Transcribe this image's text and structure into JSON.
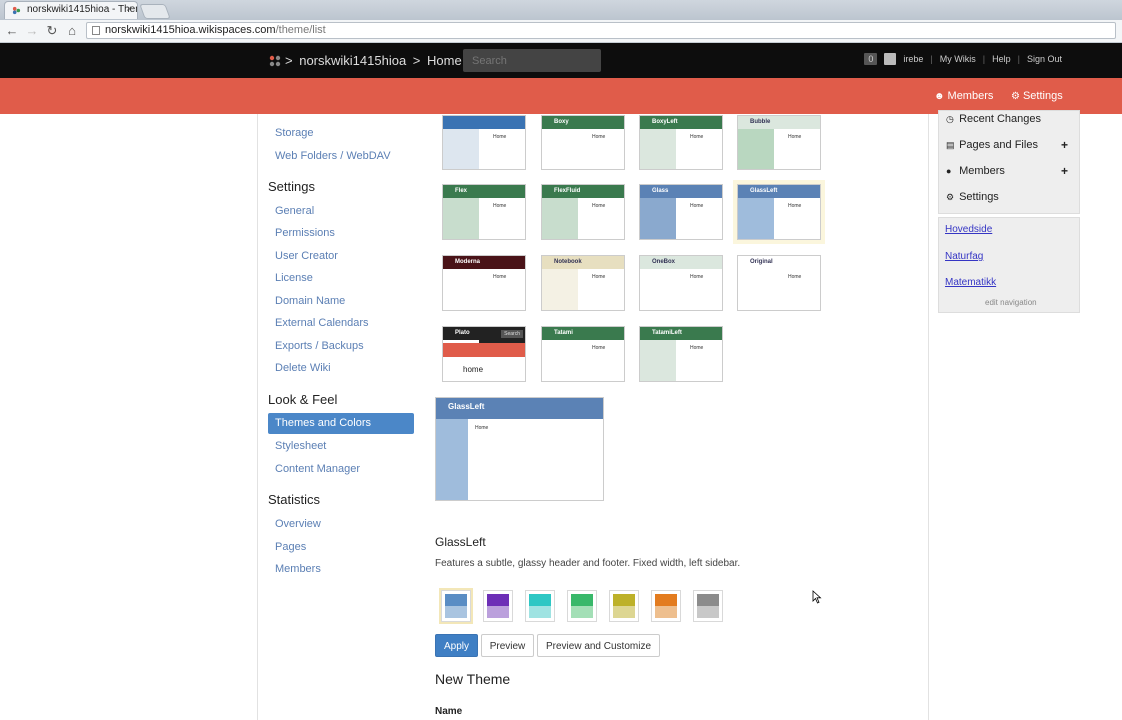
{
  "browser": {
    "tab_title": "norskwiki1415hioa - Them",
    "tab_close": "×",
    "url_host": "norskwiki1415hioa.wikispaces.com",
    "url_path": "/theme/list"
  },
  "header": {
    "wiki_name": "norskwiki1415hioa",
    "separator": ">",
    "home": "Home",
    "search_placeholder": "Search",
    "badge": "0",
    "user": "irebe",
    "links": [
      "My Wikis",
      "Help",
      "Sign Out"
    ],
    "link_sep": "|"
  },
  "subheader": {
    "members": "Members",
    "settings": "Settings"
  },
  "leftnav": {
    "top_links": [
      "Storage",
      "Web Folders / WebDAV"
    ],
    "settings_heading": "Settings",
    "settings_links": [
      "General",
      "Permissions",
      "User Creator",
      "License",
      "Domain Name",
      "External Calendars",
      "Exports / Backups",
      "Delete Wiki"
    ],
    "look_heading": "Look & Feel",
    "look_links": [
      "Themes and Colors",
      "Stylesheet",
      "Content Manager"
    ],
    "stats_heading": "Statistics",
    "stats_links": [
      "Overview",
      "Pages",
      "Members"
    ]
  },
  "themes": {
    "thumbs": [
      {
        "name": "",
        "header_color": "#3a73b3",
        "sidebar_color": "#dde6ef",
        "home": "Home"
      },
      {
        "name": "Boxy",
        "header_color": "#3a7a4e",
        "sidebar_color": "#ffffff",
        "home": "Home"
      },
      {
        "name": "BoxyLeft",
        "header_color": "#3a7a4e",
        "sidebar_color": "#dbe7de",
        "home": "Home"
      },
      {
        "name": "Bubble",
        "header_color": "#dbe7de",
        "sidebar_color": "#b9d7c0",
        "home": "Home"
      },
      {
        "name": "Flex",
        "header_color": "#3a7a4e",
        "sidebar_color": "#c8ddcd",
        "home": "Home"
      },
      {
        "name": "FlexFluid",
        "header_color": "#3a7a4e",
        "sidebar_color": "#c8ddcd",
        "home": "Home"
      },
      {
        "name": "Glass",
        "header_color": "#5b82b5",
        "sidebar_color": "#8aa9ce",
        "home": "Home"
      },
      {
        "name": "GlassLeft",
        "header_color": "#5b82b5",
        "sidebar_color": "#9fbcdc",
        "home": "Home"
      },
      {
        "name": "Moderna",
        "header_color": "#4a1318",
        "sidebar_color": "#ffffff",
        "home": "Home"
      },
      {
        "name": "Notebook",
        "header_color": "#e7dfc0",
        "sidebar_color": "#f4f1e4",
        "home": "Home"
      },
      {
        "name": "OneBox",
        "header_color": "#dbe7de",
        "sidebar_color": "#ffffff",
        "home": "Home"
      },
      {
        "name": "Original",
        "header_color": "#ffffff",
        "sidebar_color": "#ffffff",
        "home": "Home"
      },
      {
        "name": "Plato",
        "header_color": "#222222",
        "sidebar_color": "#ffffff",
        "home": "home"
      },
      {
        "name": "Tatami",
        "header_color": "#3a7a4e",
        "sidebar_color": "#ffffff",
        "home": "Home"
      },
      {
        "name": "TatamiLeft",
        "header_color": "#3a7a4e",
        "sidebar_color": "#dbe7de",
        "home": "Home"
      }
    ],
    "plato_search": "Search",
    "big_preview": {
      "name": "GlassLeft",
      "home": "Home"
    },
    "selected_name": "GlassLeft",
    "selected_desc": "Features a subtle, glassy header and footer. Fixed width, left sidebar.",
    "swatches": [
      {
        "top": "#5a8dc4",
        "bottom": "#a9c4e0"
      },
      {
        "top": "#6d2fb6",
        "bottom": "#bba0dc"
      },
      {
        "top": "#2ec7c4",
        "bottom": "#9fe3e2"
      },
      {
        "top": "#39b86a",
        "bottom": "#a3dfb6"
      },
      {
        "top": "#bdb12a",
        "bottom": "#ddd692"
      },
      {
        "top": "#e37c1f",
        "bottom": "#eebf8e"
      },
      {
        "top": "#8c8c8c",
        "bottom": "#c8c8c8"
      }
    ],
    "apply": "Apply",
    "preview": "Preview",
    "preview_customize": "Preview and Customize",
    "new_theme": "New Theme",
    "name_label": "Name"
  },
  "sidebar": {
    "items": [
      {
        "icon": "clock-icon",
        "label": "Recent Changes",
        "plus": false
      },
      {
        "icon": "file-icon",
        "label": "Pages and Files",
        "plus": true
      },
      {
        "icon": "user-icon",
        "label": "Members",
        "plus": true
      },
      {
        "icon": "gear-icon",
        "label": "Settings",
        "plus": false
      }
    ],
    "nav_links": [
      "Hovedside",
      "Naturfag",
      "Matematikk"
    ],
    "edit_nav": "edit navigation"
  },
  "colors": {
    "accent_bar": "#e05c4a",
    "active_nav": "#4b87c8",
    "link": "#5b7fb4"
  }
}
